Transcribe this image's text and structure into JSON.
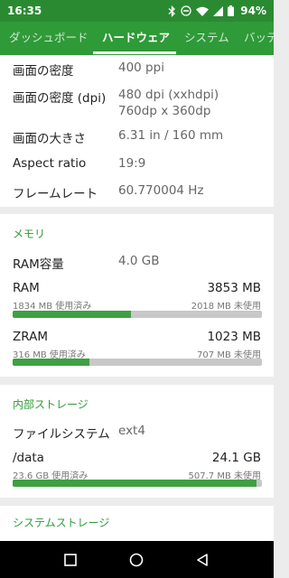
{
  "status_bar": {
    "time": "16:35",
    "battery": "94%"
  },
  "tabs": [
    "ダッシュボード",
    "ハードウェア",
    "システム",
    "バッテ"
  ],
  "display": {
    "rows": [
      {
        "label": "画面の密度",
        "value": "400 ppi"
      },
      {
        "label": "画面の密度 (dpi)",
        "value": "480 dpi (xxhdpi)",
        "value2": "760dp x 360dp"
      },
      {
        "label": "画面の大きさ",
        "value": "6.31 in / 160 mm"
      },
      {
        "label": "Aspect ratio",
        "value": "19:9"
      },
      {
        "label": "フレームレート",
        "value": "60.770004 Hz"
      }
    ]
  },
  "memory": {
    "title": "メモリ",
    "ram_capacity_label": "RAM容量",
    "ram_capacity_value": "4.0 GB",
    "ram": {
      "name": "RAM",
      "total": "3853 MB",
      "used": "1834 MB 使用済み",
      "free": "2018 MB 未使用",
      "fill": 0.476
    },
    "zram": {
      "name": "ZRAM",
      "total": "1023 MB",
      "used": "316 MB 使用済み",
      "free": "707 MB 未使用",
      "fill": 0.309
    }
  },
  "storage": {
    "title": "内部ストレージ",
    "fs_label": "ファイルシステム",
    "fs_value": "ext4",
    "data": {
      "name": "/data",
      "total": "24.1 GB",
      "used": "23.6 GB 使用済み",
      "free": "507.7 MB 未使用",
      "fill": 0.979
    }
  },
  "system_storage": {
    "title": "システムストレージ"
  },
  "colors": {
    "status_bar": "#2a8a32",
    "toolbar": "#2f9a38",
    "accent": "#2f9a38",
    "bar_fill": "#3ea043",
    "bar_track": "#c8c8c8"
  }
}
